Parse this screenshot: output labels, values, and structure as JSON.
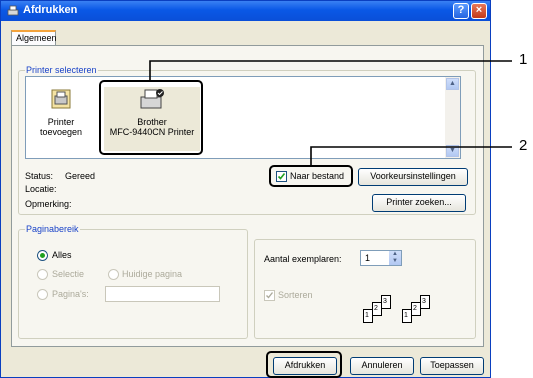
{
  "window": {
    "title": "Afdrukken",
    "help_label": "?",
    "close_label": "×"
  },
  "tabs": [
    {
      "label": "Algemeen"
    }
  ],
  "printer_select": {
    "group_label": "Printer selecteren",
    "printers": [
      {
        "line1": "Printer",
        "line2": "toevoegen"
      },
      {
        "line1": "Brother",
        "line2": "MFC-9440CN Printer"
      }
    ],
    "status_label": "Status:",
    "status_value": "Gereed",
    "location_label": "Locatie:",
    "comment_label": "Opmerking:",
    "print_to_file_label": "Naar bestand",
    "print_to_file_checked": true,
    "preferences_button": "Voorkeursinstellingen",
    "find_printer_button": "Printer zoeken..."
  },
  "page_range": {
    "group_label": "Paginabereik",
    "all_label": "Alles",
    "selection_label": "Selectie",
    "current_page_label": "Huidige pagina",
    "pages_label": "Pagina's:",
    "pages_value": "",
    "copies_label": "Aantal exemplaren:",
    "copies_value": "1",
    "collate_label": "Sorteren",
    "collate_pages": [
      "1",
      "2",
      "3",
      "1",
      "2",
      "3"
    ]
  },
  "footer": {
    "print_button": "Afdrukken",
    "cancel_button": "Annuleren",
    "apply_button": "Toepassen"
  },
  "callouts": {
    "one": "1",
    "two": "2"
  }
}
